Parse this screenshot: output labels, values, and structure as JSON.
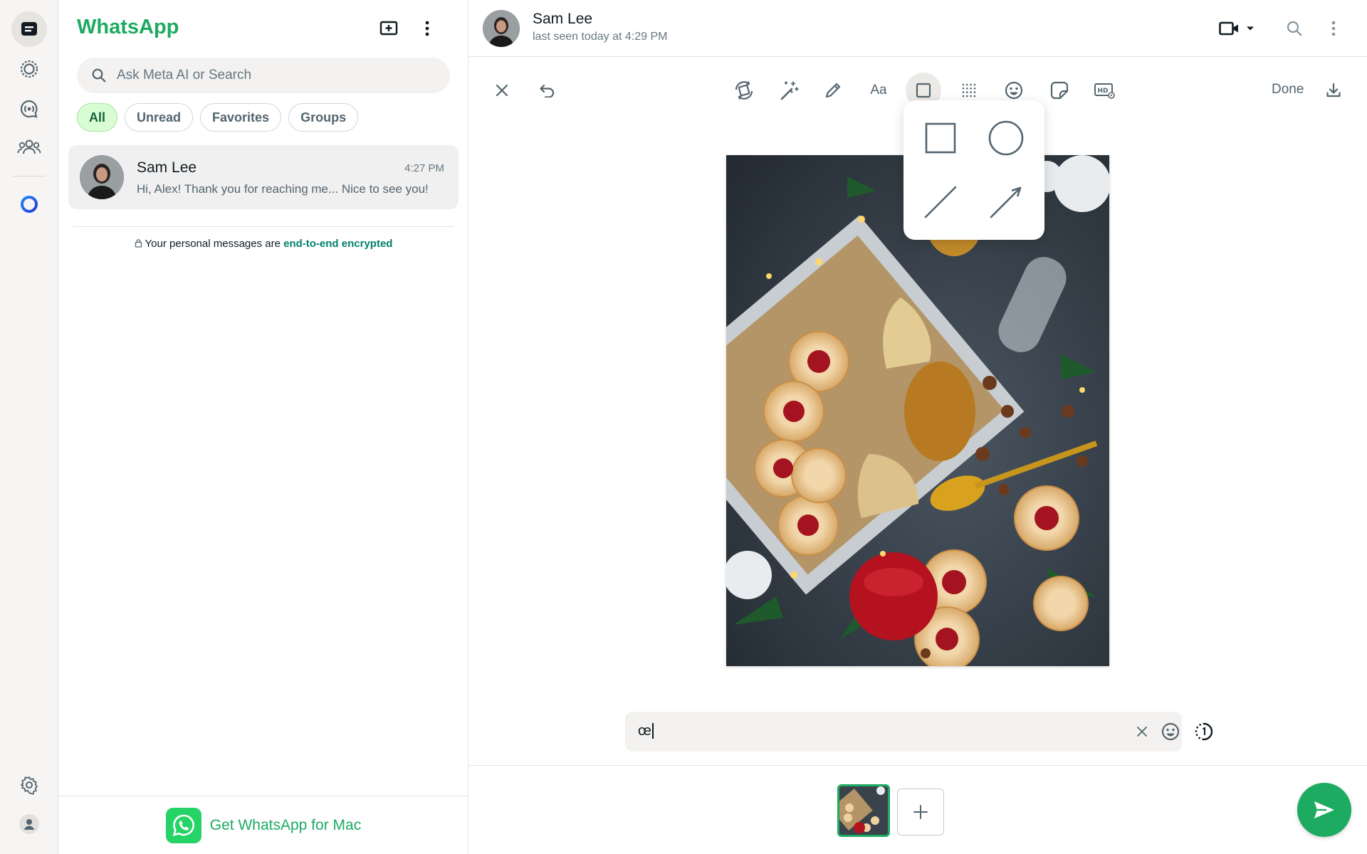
{
  "rail": {
    "items": [
      {
        "name": "chats",
        "icon": "chats-icon"
      },
      {
        "name": "status",
        "icon": "status-icon"
      },
      {
        "name": "channels",
        "icon": "channels-icon"
      },
      {
        "name": "communities",
        "icon": "communities-icon"
      },
      {
        "name": "meta-ai",
        "icon": "meta-ai-icon"
      },
      {
        "name": "settings",
        "icon": "gear-icon"
      },
      {
        "name": "profile",
        "icon": "profile-icon"
      }
    ]
  },
  "list": {
    "brand": "WhatsApp",
    "search_placeholder": "Ask Meta AI or Search",
    "filters": [
      "All",
      "Unread",
      "Favorites",
      "Groups"
    ],
    "active_filter": "All",
    "chats": [
      {
        "name": "Sam Lee",
        "time": "4:27 PM",
        "preview": "Hi, Alex! Thank you for reaching me... Nice to see you!"
      }
    ],
    "encryption_prefix": "Your personal messages are ",
    "encryption_link": "end-to-end encrypted",
    "get_app": "Get WhatsApp for Mac"
  },
  "header": {
    "name": "Sam Lee",
    "status": "last seen today at 4:29 PM"
  },
  "editor": {
    "done_label": "Done",
    "active_tool": "shapes",
    "shape_options": [
      "square",
      "circle",
      "line",
      "arrow"
    ],
    "caption_value": "œ"
  },
  "colors": {
    "brand_green": "#1daa61",
    "link_green": "#008069",
    "active_chip_bg": "#d9fdd3"
  }
}
